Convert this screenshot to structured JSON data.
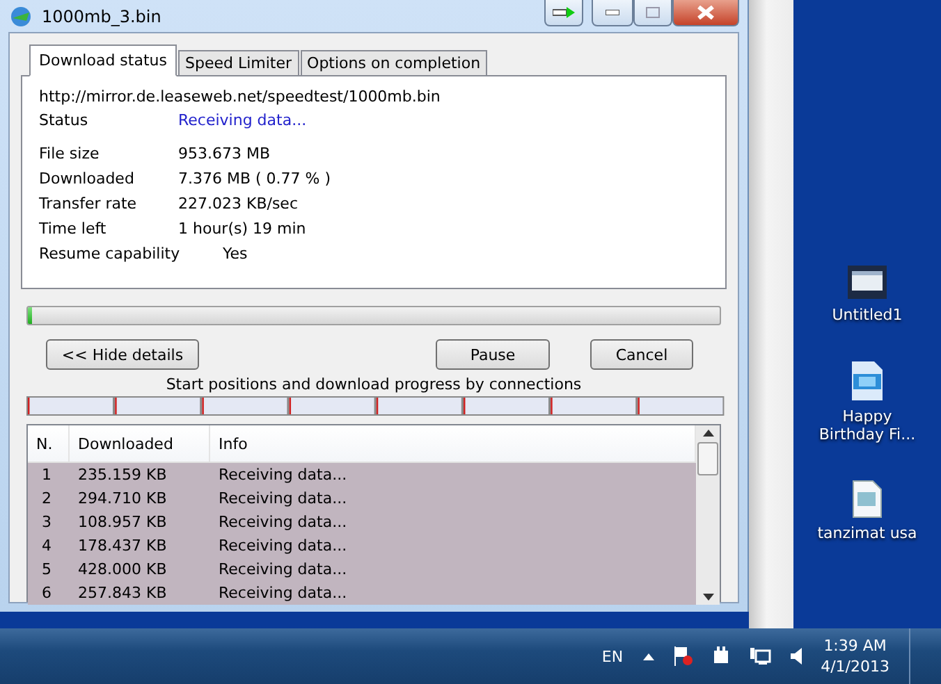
{
  "window": {
    "title": "1000mb_3.bin"
  },
  "tabs": [
    {
      "label": "Download status",
      "selected": true
    },
    {
      "label": "Speed Limiter",
      "selected": false
    },
    {
      "label": "Options on completion",
      "selected": false
    }
  ],
  "url": "http://mirror.de.leaseweb.net/speedtest/1000mb.bin",
  "status": {
    "label": "Status",
    "value": "Receiving data..."
  },
  "details": [
    {
      "label": "File size",
      "value": "953.673  MB"
    },
    {
      "label": "Downloaded",
      "value": "7.376  MB  ( 0.77 % )"
    },
    {
      "label": "Transfer rate",
      "value": "227.023  KB/sec"
    },
    {
      "label": "Time left",
      "value": "1 hour(s) 19 min"
    },
    {
      "label": "Resume capability",
      "value": "Yes"
    }
  ],
  "progress": {
    "level": 0.006
  },
  "buttons": {
    "hide": "<< Hide details",
    "pause": "Pause",
    "cancel": "Cancel"
  },
  "connections_caption": "Start positions and download progress by connections",
  "connections": [
    {
      "level": 0.02
    },
    {
      "level": 0.02
    },
    {
      "level": 0.02
    },
    {
      "level": 0.02
    },
    {
      "level": 0.02
    },
    {
      "level": 0.02
    },
    {
      "level": 0.02
    },
    {
      "level": 0.02
    }
  ],
  "table": {
    "columns": [
      "N.",
      "Downloaded",
      "Info"
    ],
    "rows": [
      [
        "1",
        "235.159  KB",
        "Receiving data..."
      ],
      [
        "2",
        "294.710  KB",
        "Receiving data..."
      ],
      [
        "3",
        "108.957  KB",
        "Receiving data..."
      ],
      [
        "4",
        "178.437  KB",
        "Receiving data..."
      ],
      [
        "5",
        "428.000  KB",
        "Receiving data..."
      ],
      [
        "6",
        "257.843  KB",
        "Receiving data..."
      ]
    ]
  },
  "desktop_icons": [
    {
      "label": "Untitled1",
      "kind": "video"
    },
    {
      "label": "Happy Birthday Fi...",
      "kind": "movie"
    },
    {
      "label": "tanzimat usa",
      "kind": "text"
    }
  ],
  "taskbar": {
    "language": "EN",
    "time": "1:39 AM",
    "date": "4/1/2013"
  }
}
